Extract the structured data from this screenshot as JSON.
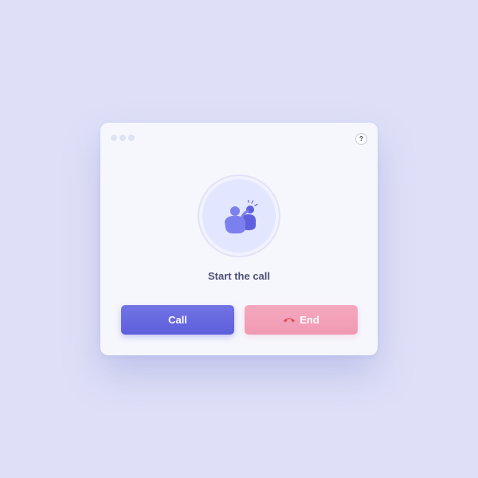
{
  "dialog": {
    "title": "Start the call",
    "window_dots": [
      "dot",
      "dot",
      "dot"
    ],
    "help_label": "?",
    "avatar_icon": "people-call-icon"
  },
  "actions": {
    "call_label": "Call",
    "end_label": "End",
    "end_icon": "hangup-phone-icon"
  },
  "colors": {
    "page_background": "#dfe0f7",
    "card_background": "#f6f7fd",
    "call_button": "#6668e0",
    "end_button": "#f3a2b9",
    "title_text": "#4e5177",
    "icon_accent": "#6b6ee6"
  }
}
